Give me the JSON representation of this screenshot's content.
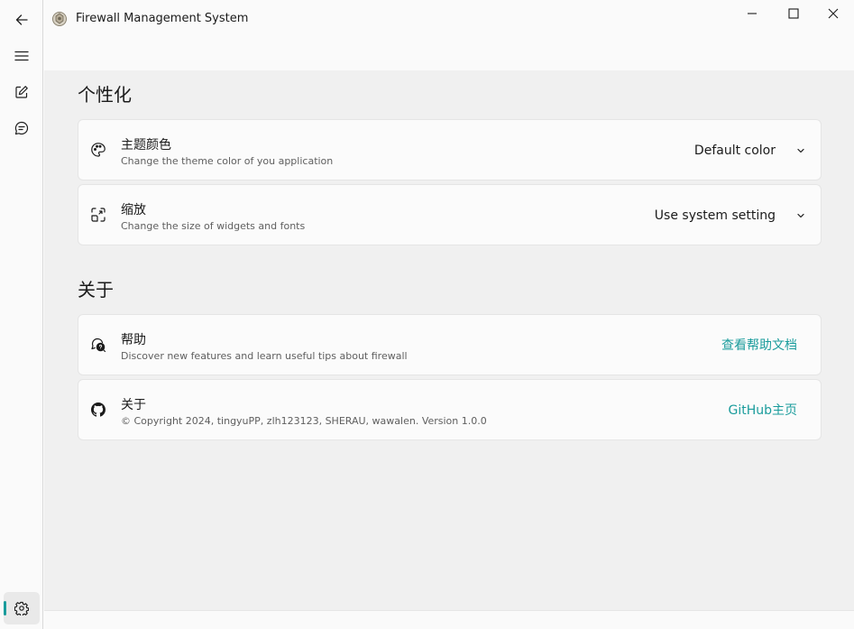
{
  "window": {
    "title": "Firewall Management System"
  },
  "nav": {
    "items": [
      {
        "icon": "back-arrow-icon"
      },
      {
        "icon": "hamburger-menu-icon"
      },
      {
        "icon": "edit-icon"
      },
      {
        "icon": "chat-icon"
      }
    ],
    "settings_icon": "gear-icon",
    "accent_color": "#1a9c9c"
  },
  "personalization": {
    "section_title": "个性化",
    "theme": {
      "title": "主题颜色",
      "description": "Change the theme color of you application",
      "value": "Default color",
      "icon": "palette-icon"
    },
    "zoom": {
      "title": "缩放",
      "description": "Change the size of widgets and fonts",
      "value": "Use system setting",
      "icon": "zoom-icon"
    }
  },
  "about": {
    "section_title": "关于",
    "help": {
      "title": "帮助",
      "description": "Discover new features and learn useful tips about firewall",
      "link": "查看帮助文档",
      "icon": "help-icon"
    },
    "info": {
      "title": "关于",
      "description": "© Copyright 2024, tingyuPP, zlh123123, SHERAU, wawalen. Version 1.0.0",
      "link": "GitHub主页",
      "icon": "github-icon"
    }
  },
  "colors": {
    "accent": "#1a9c9c",
    "content_bg": "#f0f0f0",
    "card_bg": "#fbfbfb"
  }
}
